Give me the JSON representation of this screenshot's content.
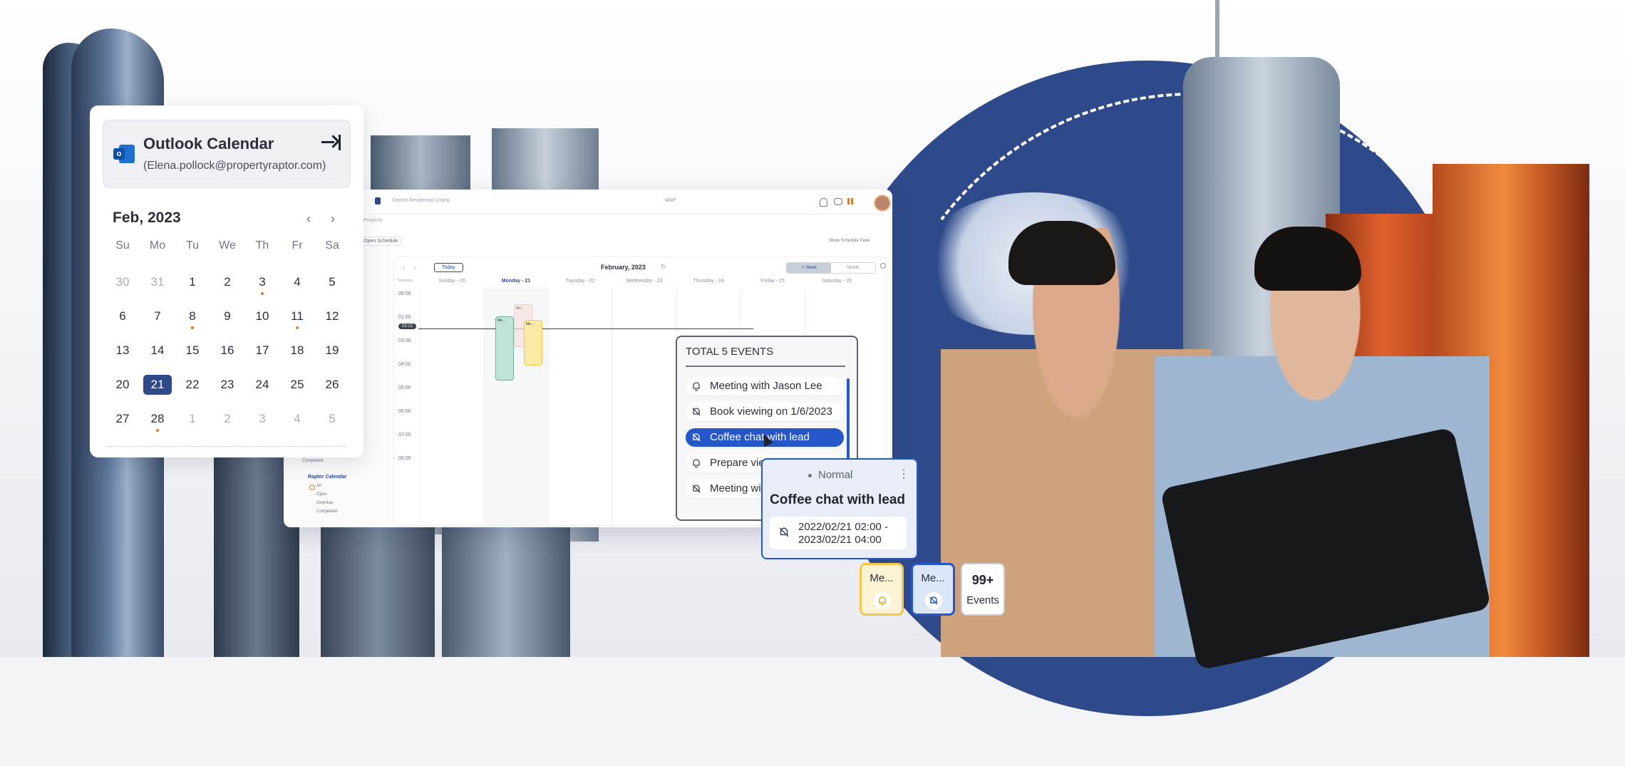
{
  "app": {
    "search_placeholder": "Search Residential Listing",
    "map_label": "MAP",
    "breadcrumb": "Property",
    "open_schedule": "Open Schedule",
    "show_schedule_pane": "Show Schedule Pane",
    "calendar": {
      "today": "Today",
      "month_title": "February, 2023",
      "view_week": "✓ Week",
      "view_month": "Month",
      "timezone": "Timezone",
      "days": [
        "Sunday - 20",
        "Monday - 21",
        "Tuesday - 22",
        "Wednesday - 23",
        "Thursday - 24",
        "Friday - 25",
        "Saturday - 26"
      ],
      "hours": [
        "00:00",
        "01:00",
        "02:12",
        "03:00",
        "04:00",
        "05:00",
        "06:00",
        "07:00",
        "08:00"
      ],
      "event_labels": [
        "Me...",
        "Me...",
        "Me..."
      ]
    },
    "raptor_calendar": {
      "title": "Raptor Calendar",
      "filters": [
        "All",
        "Open",
        "Overdue",
        "Completed"
      ],
      "completed_top": "Completed"
    }
  },
  "outlook": {
    "title": "Outlook Calendar",
    "email": "(Elena.pollock@propertyraptor.com)",
    "month": "Feb, 2023",
    "weekdays": [
      "Su",
      "Mo",
      "Tu",
      "We",
      "Th",
      "Fr",
      "Sa"
    ],
    "weeks": [
      [
        "30",
        "31",
        "1",
        "2",
        "3",
        "4",
        "5"
      ],
      [
        "6",
        "7",
        "8",
        "9",
        "10",
        "11",
        "12"
      ],
      [
        "13",
        "14",
        "15",
        "16",
        "17",
        "18",
        "19"
      ],
      [
        "20",
        "21",
        "22",
        "23",
        "24",
        "25",
        "26"
      ],
      [
        "27",
        "28",
        "1",
        "2",
        "3",
        "4",
        "5"
      ]
    ],
    "selected_day": "21",
    "days_with_events": [
      "3",
      "8",
      "11",
      "28"
    ]
  },
  "events_popup": {
    "title": "TOTAL 5 EVENTS",
    "items": [
      {
        "label": "Meeting with Jason Lee",
        "icon": "bell-icon"
      },
      {
        "label": "Book viewing on 1/6/2023",
        "icon": "bell-off-icon"
      },
      {
        "label": "Coffee chat with lead",
        "icon": "bell-off-icon",
        "selected": true
      },
      {
        "label": "Prepare vie",
        "icon": "bell-icon"
      },
      {
        "label": "Meeting wi",
        "icon": "bell-off-icon"
      }
    ]
  },
  "detail": {
    "priority": "Normal",
    "more": "⋮",
    "title": "Coffee chat with lead",
    "time": "2022/02/21 02:00 -\n2023/02/21 04:00"
  },
  "chips": [
    {
      "label": "Me...",
      "icon": "bell-icon",
      "accent": "#f2c84a"
    },
    {
      "label": "Me...",
      "icon": "bell-off-icon",
      "accent": "#2557c9"
    }
  ],
  "count_chip": {
    "count": "99+",
    "label": "Events"
  },
  "colors": {
    "brand_blue": "#2f4a8a",
    "selected_blue": "#2557c9",
    "event_dot": "#e07a2b",
    "event_yellow": "#f2c84a",
    "event_green": "#8fc7b5"
  }
}
